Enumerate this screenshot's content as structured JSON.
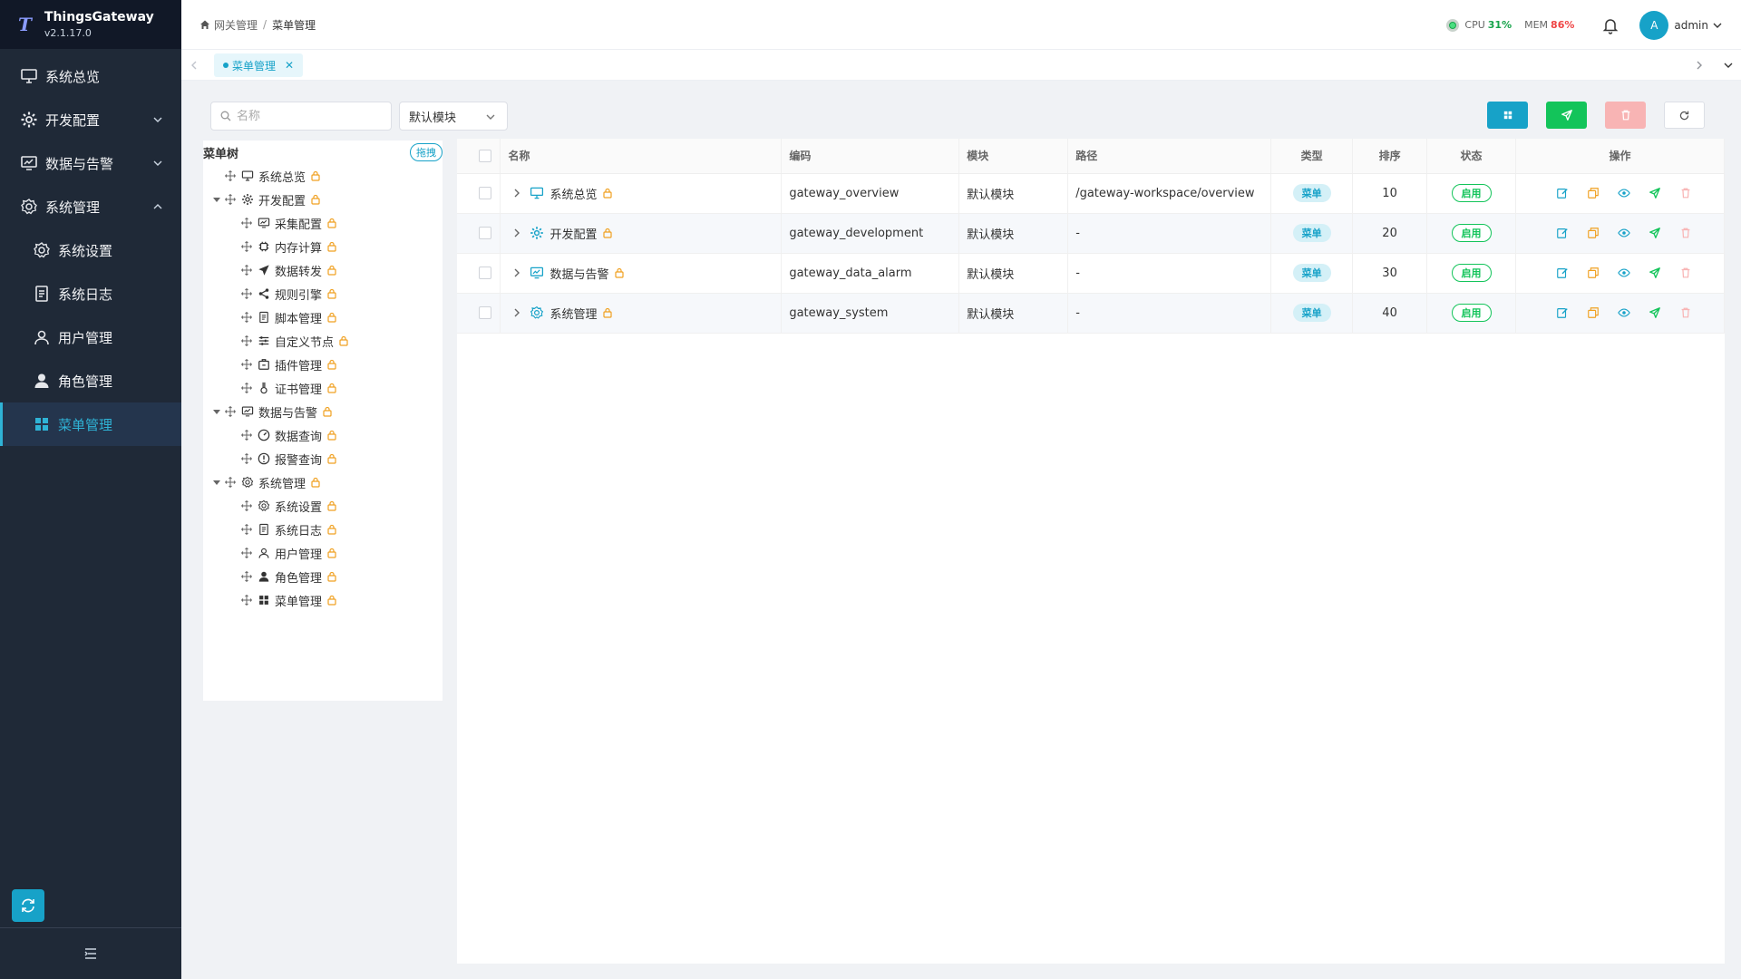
{
  "app": {
    "name": "ThingsGateway",
    "version": "v2.1.17.0",
    "logo_letter": "T"
  },
  "sidebar": {
    "items": [
      {
        "label": "系统总览",
        "icon": "monitor-icon"
      },
      {
        "label": "开发配置",
        "icon": "gear-icon",
        "expandable": true
      },
      {
        "label": "数据与告警",
        "icon": "dashboard-icon",
        "expandable": true
      },
      {
        "label": "系统管理",
        "icon": "settings-icon",
        "expanded": true
      },
      {
        "label": "系统设置",
        "icon": "settings-icon"
      },
      {
        "label": "系统日志",
        "icon": "document-icon"
      },
      {
        "label": "用户管理",
        "icon": "user-icon"
      },
      {
        "label": "角色管理",
        "icon": "user-filled-icon"
      },
      {
        "label": "菜单管理",
        "icon": "grid-icon",
        "active": true
      }
    ]
  },
  "header": {
    "breadcrumb": [
      "网关管理",
      "菜单管理"
    ],
    "cpu_label": "CPU",
    "cpu_value": "31%",
    "mem_label": "MEM",
    "mem_value": "86%",
    "user": "admin",
    "avatar_letter": "A"
  },
  "tabs": [
    {
      "label": "菜单管理",
      "active": true
    }
  ],
  "toolbar": {
    "search_placeholder": "名称",
    "module_select": "默认模块"
  },
  "tree": {
    "title": "菜单树",
    "drag_label": "拖拽",
    "nodes": [
      {
        "label": "系统总览"
      },
      {
        "label": "开发配置"
      },
      {
        "label": "采集配置"
      },
      {
        "label": "内存计算"
      },
      {
        "label": "数据转发"
      },
      {
        "label": "规则引擎"
      },
      {
        "label": "脚本管理"
      },
      {
        "label": "自定义节点"
      },
      {
        "label": "插件管理"
      },
      {
        "label": "证书管理"
      },
      {
        "label": "数据与告警"
      },
      {
        "label": "数据查询"
      },
      {
        "label": "报警查询"
      },
      {
        "label": "系统管理"
      },
      {
        "label": "系统设置"
      },
      {
        "label": "系统日志"
      },
      {
        "label": "用户管理"
      },
      {
        "label": "角色管理"
      },
      {
        "label": "菜单管理"
      }
    ]
  },
  "table": {
    "columns": [
      "名称",
      "编码",
      "模块",
      "路径",
      "类型",
      "排序",
      "状态",
      "操作"
    ],
    "rows": [
      {
        "name": "系统总览",
        "code": "gateway_overview",
        "module": "默认模块",
        "path": "/gateway-workspace/overview",
        "type": "菜单",
        "sort": "10",
        "status": "启用"
      },
      {
        "name": "开发配置",
        "code": "gateway_development",
        "module": "默认模块",
        "path": "-",
        "type": "菜单",
        "sort": "20",
        "status": "启用"
      },
      {
        "name": "数据与告警",
        "code": "gateway_data_alarm",
        "module": "默认模块",
        "path": "-",
        "type": "菜单",
        "sort": "30",
        "status": "启用"
      },
      {
        "name": "系统管理",
        "code": "gateway_system",
        "module": "默认模块",
        "path": "-",
        "type": "菜单",
        "sort": "40",
        "status": "启用"
      }
    ]
  },
  "colors": {
    "accent": "#17a2c8",
    "sidebar_bg": "#1f2937",
    "success": "#13c45a",
    "danger": "#ef4444",
    "lock": "#f0a020"
  }
}
